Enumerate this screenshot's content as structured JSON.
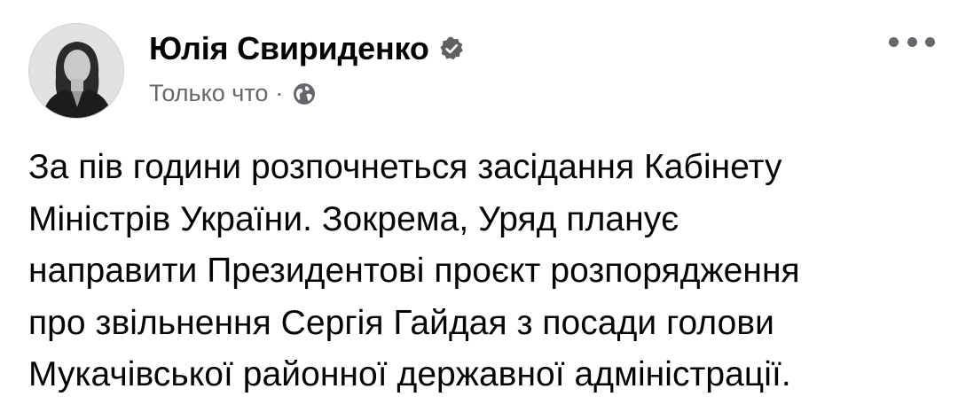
{
  "post": {
    "author": "Юлія Свириденко",
    "verified": true,
    "timestamp": "Только что",
    "separator": "·",
    "privacy_icon": "globe-icon",
    "more_icon": "more-options-icon",
    "body_lines": [
      "За пів години розпочнеться засідання Кабінету",
      "Міністрів України. Зокрема, Уряд планує",
      "направити Президентові проєкт розпорядження",
      "про звільнення Сергія Гайдая з посади голови",
      "Мукачівської районної державної адміністрації."
    ]
  },
  "colors": {
    "primary_text": "#050505",
    "secondary_text": "#65676b",
    "verified_badge": "#606060"
  }
}
